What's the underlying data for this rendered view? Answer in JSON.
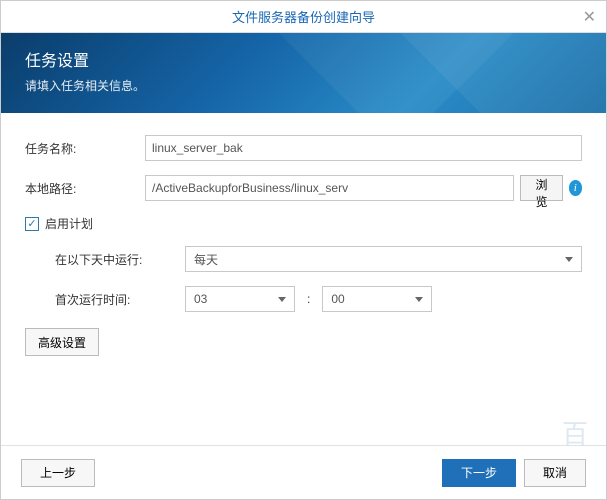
{
  "dialog": {
    "title": "文件服务器备份创建向导",
    "close": "✕"
  },
  "banner": {
    "heading": "任务设置",
    "subtitle": "请填入任务相关信息。"
  },
  "form": {
    "taskNameLabel": "任务名称:",
    "taskNameValue": "linux_server_bak",
    "localPathLabel": "本地路径:",
    "localPathValue": "/ActiveBackupforBusiness/linux_serv",
    "browseLabel": "浏览",
    "infoGlyph": "i",
    "enableScheduleLabel": "启用计划",
    "checkGlyph": "✓",
    "runOnDaysLabel": "在以下天中运行:",
    "runOnDaysValue": "每天",
    "firstRunLabel": "首次运行时间:",
    "hourValue": "03",
    "minuteValue": "00",
    "colon": ":",
    "advancedLabel": "高级设置"
  },
  "footer": {
    "back": "上一步",
    "next": "下一步",
    "cancel": "取消"
  },
  "watermark": "百"
}
